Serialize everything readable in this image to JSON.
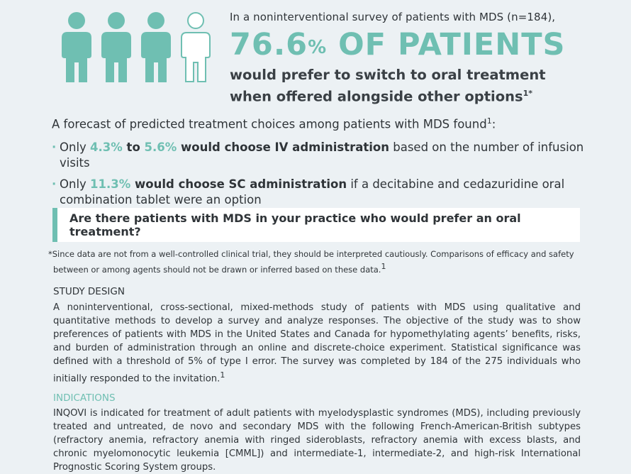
{
  "colors": {
    "accent": "#6fbfb2",
    "text": "#2f3438",
    "background": "#ecf1f4",
    "callout_bg": "#ffffff"
  },
  "icons": [
    "person-filled-icon",
    "person-filled-icon",
    "person-filled-icon",
    "person-outline-icon"
  ],
  "headline": {
    "intro": "In a noninterventional survey of patients with MDS (n=184),",
    "big_number": "76.6",
    "big_percent": "%",
    "big_text": " OF PATIENTS",
    "sub_line1": "would prefer to switch to oral treatment",
    "sub_line2": "when offered alongside other options",
    "sub_line2_sup": "1*"
  },
  "forecast": {
    "text": "A forecast of predicted treatment choices among patients with MDS found",
    "sup": "1",
    "end": ":"
  },
  "bullets": {
    "b1_pre": "Only ",
    "b1_v1": "4.3%",
    "b1_mid": " to ",
    "b1_v2": "5.6%",
    "b1_bold": " would choose IV administration",
    "b1_rest": " based on the number of infusion visits",
    "b2_pre": "Only ",
    "b2_v1": "11.3%",
    "b2_bold": " would choose SC administration",
    "b2_rest": " if a decitabine and cedazuridine oral combination tablet were an option"
  },
  "callout": {
    "text": "Are there patients with MDS in your practice who would prefer an oral treatment?"
  },
  "footnote": {
    "line1": "*Since data are not from a well-controlled clinical trial, they should be interpreted cautiously. Comparisons of efficacy and safety",
    "line2": "between or among agents should not be drawn or inferred based on these data.",
    "sup": "1"
  },
  "study_design": {
    "title": "STUDY DESIGN",
    "body": "A noninterventional, cross-sectional, mixed-methods study of patients with MDS using qualitative and quantitative methods to develop a survey and analyze responses. The objective of the study was to show preferences of patients with MDS in the United States and Canada for hypomethylating agents’ benefits, risks, and burden of administration through an online and discrete-choice experiment. Statistical significance was defined with a threshold of 5% of type I error. The survey was completed by 184 of the 275 individuals who initially responded to the invitation.",
    "sup": "1"
  },
  "indications": {
    "title": "INDICATIONS",
    "body": "INQOVI is indicated for treatment of adult patients with myelodysplastic syndromes (MDS), including previously treated and untreated, de novo and secondary MDS with the following French-American-British subtypes (refractory anemia, refractory anemia with ringed sideroblasts, refractory anemia with excess blasts, and chronic myelomonocytic leukemia [CMML]) and intermediate-1, intermediate-2, and high-risk International Prognostic Scoring System groups."
  }
}
